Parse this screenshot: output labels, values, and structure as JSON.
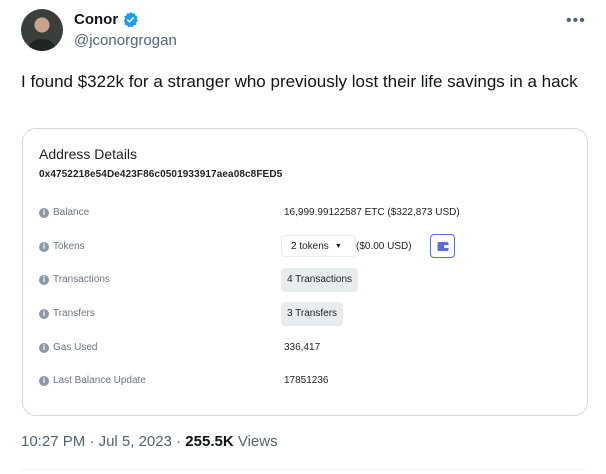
{
  "author": {
    "name": "Conor",
    "handle": "@jconorgrogan"
  },
  "tweet": {
    "text": "I found $322k for a stranger who previously lost their life savings in a hack"
  },
  "card": {
    "title": "Address Details",
    "address": "0x4752218e54De423F86c0501933917aea08c8FED5",
    "rows": {
      "balance_label": "Balance",
      "balance_value": "16,999.99122587 ETC ($322,873 USD)",
      "tokens_label": "Tokens",
      "tokens_dropdown": "2 tokens",
      "tokens_usd": "($0.00 USD)",
      "transactions_label": "Transactions",
      "transactions_value": "4 Transactions",
      "transfers_label": "Transfers",
      "transfers_value": "3 Transfers",
      "gas_label": "Gas Used",
      "gas_value": "336,417",
      "last_update_label": "Last Balance Update",
      "last_update_value": "17851236"
    }
  },
  "footer": {
    "time": "10:27 PM",
    "date": "Jul 5, 2023",
    "views_count": "255.5K",
    "views_label": "Views",
    "separator": "·"
  },
  "colors": {
    "verified": "#1d9bf0",
    "secondary_text": "#536471",
    "wallet_accent": "#5b6be0"
  },
  "icons": {
    "more": "more-horizontal-icon",
    "verified": "verified-badge-icon",
    "info": "info-circle-icon",
    "wallet": "wallet-icon",
    "caret": "caret-down-icon"
  }
}
